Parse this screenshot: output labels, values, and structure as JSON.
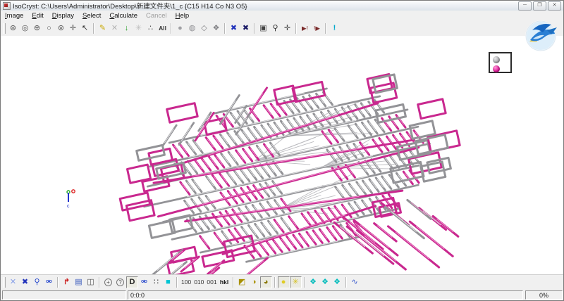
{
  "window": {
    "title": "IsoCryst: C:\\Users\\Administrator\\Desktop\\新建文件夹\\1_c {C15 H14 Co N3 O5}",
    "controls": {
      "minimize": "─",
      "maximize": "❒",
      "close": "✕"
    }
  },
  "menu": {
    "items": [
      {
        "label": "Image",
        "u": 0,
        "enabled": true
      },
      {
        "label": "Edit",
        "u": 0,
        "enabled": true
      },
      {
        "label": "Display",
        "u": 0,
        "enabled": true
      },
      {
        "label": "Select",
        "u": 0,
        "enabled": true
      },
      {
        "label": "Calculate",
        "u": 0,
        "enabled": true
      },
      {
        "label": "Cancel",
        "u": -1,
        "enabled": false
      },
      {
        "label": "Help",
        "u": 0,
        "enabled": true
      }
    ]
  },
  "toolbar_top": {
    "groups": [
      [
        {
          "n": "rotate-sphere-icon",
          "g": "⊛",
          "c": "#555555"
        },
        {
          "n": "concentric-circles-icon",
          "g": "◎",
          "c": "#555555"
        },
        {
          "n": "atom-sphere-icon",
          "g": "⊕",
          "c": "#555555"
        },
        {
          "n": "open-circle-icon",
          "g": "○",
          "c": "#555555"
        },
        {
          "n": "bond-angle-icon",
          "g": "⊚",
          "c": "#555555"
        },
        {
          "n": "translate-icon",
          "g": "✛",
          "c": "#555555"
        },
        {
          "n": "pointer-arrow-icon",
          "g": "↖",
          "c": "#333333"
        }
      ],
      [
        {
          "n": "draw-pencil-icon",
          "g": "✎",
          "c": "#c8a800"
        },
        {
          "n": "delete-cross-icon",
          "g": "✕",
          "c": "#b4b4b4"
        },
        {
          "n": "grow-down-arrow-icon",
          "g": "↓",
          "c": "#1f9e1f",
          "b": 1
        },
        {
          "n": "rays-disabled-icon",
          "g": "✳",
          "c": "#bcbcbc"
        },
        {
          "n": "dots-icon",
          "g": "∴",
          "c": "#555555"
        },
        {
          "n": "select-all-button",
          "g": "All",
          "c": "#333333",
          "t": 1,
          "b": 1
        }
      ],
      [
        {
          "n": "sphere-gray-icon",
          "g": "●",
          "c": "#a0a0a4"
        },
        {
          "n": "sphere-net-icon",
          "g": "◍",
          "c": "#909094"
        },
        {
          "n": "polyhedron-icon",
          "g": "◇",
          "c": "#808084"
        },
        {
          "n": "polyhedron-rays-icon",
          "g": "❖",
          "c": "#808084"
        }
      ],
      [
        {
          "n": "cross-highlight-icon",
          "g": "✖",
          "c": "#2233bb"
        },
        {
          "n": "cross-dark-icon",
          "g": "✖",
          "c": "#1a1a66"
        }
      ],
      [
        {
          "n": "frame-in-frame-icon",
          "g": "▣",
          "c": "#444444"
        },
        {
          "n": "mouse-icon",
          "g": "⚲",
          "c": "#333333"
        },
        {
          "n": "crosshair-icon",
          "g": "✛",
          "c": "#444444"
        }
      ],
      [
        {
          "n": "run-forward-icon",
          "g": "▶!",
          "c": "#7a2a2a",
          "t": 1
        },
        {
          "n": "run-back-icon",
          "g": "!▶",
          "c": "#7a2a2a",
          "t": 1
        }
      ],
      [
        {
          "n": "info-exclaim-icon",
          "g": "!",
          "c": "#00a8cc",
          "b": 1
        }
      ]
    ]
  },
  "toolbar_bottom": {
    "groups": [
      [
        {
          "n": "cross-thin-icon",
          "g": "✕",
          "c": "#88a0e8"
        },
        {
          "n": "cross-bold-icon",
          "g": "✖",
          "c": "#2233bb"
        },
        {
          "n": "bond-single-icon",
          "g": "⚲",
          "c": "#2244cc"
        },
        {
          "n": "bond-double-icon",
          "g": "⚮",
          "c": "#2244cc"
        }
      ],
      [
        {
          "n": "axes-setup-icon",
          "g": "↱",
          "c": "#cc2222",
          "b": 1
        },
        {
          "n": "atom-columns-icon",
          "g": "▤",
          "c": "#3355bb"
        },
        {
          "n": "unit-cell-icon",
          "g": "◫",
          "c": "#555555"
        }
      ],
      [
        {
          "n": "circle-plus-icon",
          "g": "+",
          "c": "#555555",
          "s": "circled"
        },
        {
          "n": "circle-question-icon",
          "g": "?",
          "c": "#555555",
          "s": "circled"
        },
        {
          "n": "d-mode-button",
          "g": "D",
          "c": "#222222",
          "s": "pressed",
          "b": 1
        },
        {
          "n": "bond-balls-icon",
          "g": "⚮",
          "c": "#2244cc"
        },
        {
          "n": "packing-dots-icon",
          "g": "∷",
          "c": "#333333"
        },
        {
          "n": "plane-square-icon",
          "g": "■",
          "c": "#00c4d4"
        }
      ],
      [
        {
          "n": "plane-100-button",
          "g": "100",
          "c": "#333333",
          "t": 1
        },
        {
          "n": "plane-010-button",
          "g": "010",
          "c": "#333333",
          "t": 1
        },
        {
          "n": "plane-001-button",
          "g": "001",
          "c": "#333333",
          "t": 1
        },
        {
          "n": "plane-hkl-button",
          "g": "hkl",
          "c": "#111111",
          "t": 1,
          "b": 1
        }
      ],
      [
        {
          "n": "half-square-icon",
          "g": "◩",
          "c": "#a89000"
        },
        {
          "n": "half-circle-icon",
          "g": "◑",
          "c": "#a89000"
        },
        {
          "n": "shaded-circle-icon",
          "g": "◕",
          "c": "#8a7800",
          "s": "pressed"
        }
      ],
      [
        {
          "n": "yellow-sphere-icon",
          "g": "●",
          "c": "#e0cc22",
          "s": "pressed"
        },
        {
          "n": "yellow-rays-icon",
          "g": "✳",
          "c": "#d4c020",
          "s": "pressed"
        }
      ],
      [
        {
          "n": "diamond-1-icon",
          "g": "❖",
          "c": "#00bcbc"
        },
        {
          "n": "diamond-2-icon",
          "g": "❖",
          "c": "#00bcbc"
        },
        {
          "n": "diamond-3-icon",
          "g": "❖",
          "c": "#00bcbc"
        }
      ],
      [
        {
          "n": "spectrum-curve-icon",
          "g": "∿",
          "c": "#3355cc"
        }
      ]
    ]
  },
  "legend": {
    "items": [
      {
        "name": "atom-type-gray",
        "color": "#aaaaae",
        "highlight": "#e8e8ea"
      },
      {
        "name": "atom-type-magenta",
        "color": "#e0189a",
        "highlight": "#ff9ad6"
      }
    ]
  },
  "viewport": {
    "axes_colors": {
      "a": "#dd2222",
      "b": "#22aa22",
      "c": "#2233cc"
    },
    "axes_label": "c"
  },
  "structure": {
    "magenta": "#c9288f",
    "magenta_hi": "#f090cc",
    "gray": "#939397",
    "gray_hi": "#e4e4e6",
    "fan": "#bcbcc0",
    "seed": 7
  },
  "statusbar": {
    "cell": "0:0:0",
    "progress": "0%"
  }
}
